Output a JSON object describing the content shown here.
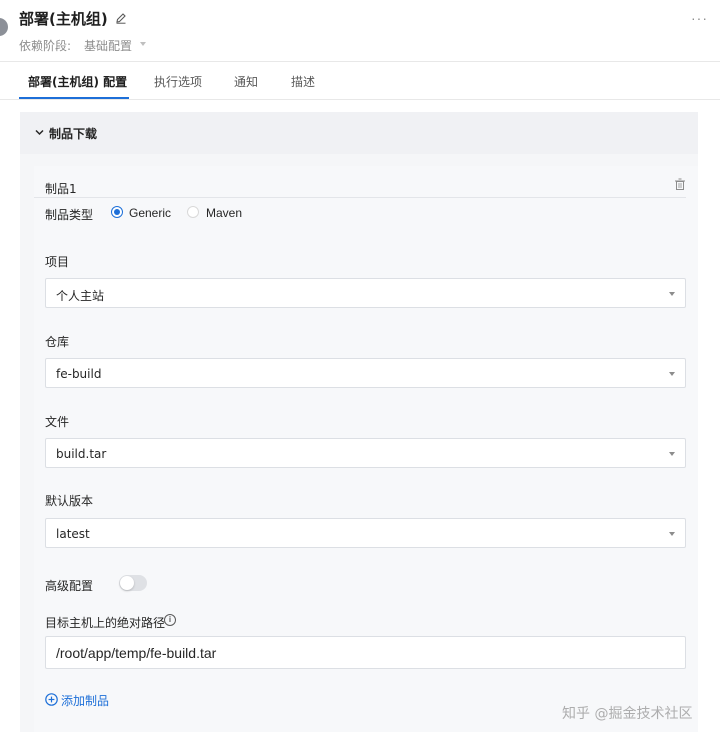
{
  "header": {
    "title": "部署(主机组)",
    "dependency_label": "依赖阶段:",
    "dependency_value": "基础配置",
    "more": "···"
  },
  "tabs": [
    {
      "label": "部署(主机组) 配置",
      "active": true
    },
    {
      "label": "执行选项",
      "active": false
    },
    {
      "label": "通知",
      "active": false
    },
    {
      "label": "描述",
      "active": false
    }
  ],
  "section": {
    "title": "制品下载",
    "expanded": true
  },
  "artifact": {
    "title": "制品1",
    "type_label": "制品类型",
    "type_options": [
      "Generic",
      "Maven"
    ],
    "type_selected": "Generic",
    "project_label": "项目",
    "project_value": "个人主站",
    "repo_label": "仓库",
    "repo_value": "fe-build",
    "file_label": "文件",
    "file_value": "build.tar",
    "version_label": "默认版本",
    "version_value": "latest",
    "advanced_label": "高级配置",
    "advanced_enabled": false,
    "path_label": "目标主机上的绝对路径",
    "path_value": "/root/app/temp/fe-build.tar"
  },
  "add_artifact_label": "添加制品",
  "watermark": "知乎 @掘金技术社区",
  "colors": {
    "accent": "#1d6fd8",
    "panel_bg": "#f5f6f8",
    "border": "#dcdfe4"
  }
}
